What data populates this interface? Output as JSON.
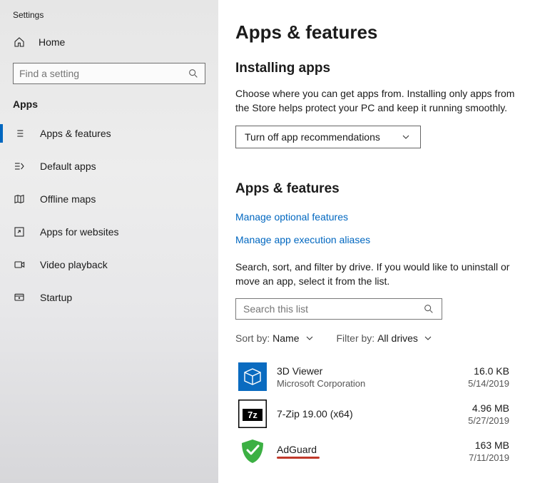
{
  "window": {
    "title": "Settings"
  },
  "sidebar": {
    "home": "Home",
    "search_placeholder": "Find a setting",
    "section": "Apps",
    "items": [
      {
        "label": "Apps & features"
      },
      {
        "label": "Default apps"
      },
      {
        "label": "Offline maps"
      },
      {
        "label": "Apps for websites"
      },
      {
        "label": "Video playback"
      },
      {
        "label": "Startup"
      }
    ]
  },
  "main": {
    "title": "Apps & features",
    "installing": {
      "heading": "Installing apps",
      "description": "Choose where you can get apps from. Installing only apps from the Store helps protect your PC and keep it running smoothly.",
      "dropdown_value": "Turn off app recommendations"
    },
    "af": {
      "heading": "Apps & features",
      "link_optional": "Manage optional features",
      "link_aliases": "Manage app execution aliases",
      "description": "Search, sort, and filter by drive. If you would like to uninstall or move an app, select it from the list.",
      "search_placeholder": "Search this list",
      "sort_label": "Sort by:",
      "sort_value": "Name",
      "filter_label": "Filter by:",
      "filter_value": "All drives"
    },
    "apps": [
      {
        "name": "3D Viewer",
        "publisher": "Microsoft Corporation",
        "size": "16.0 KB",
        "date": "5/14/2019"
      },
      {
        "name": "7-Zip 19.00 (x64)",
        "publisher": "",
        "size": "4.96 MB",
        "date": "5/27/2019"
      },
      {
        "name": "AdGuard",
        "publisher": "",
        "size": "163 MB",
        "date": "7/11/2019"
      }
    ]
  }
}
